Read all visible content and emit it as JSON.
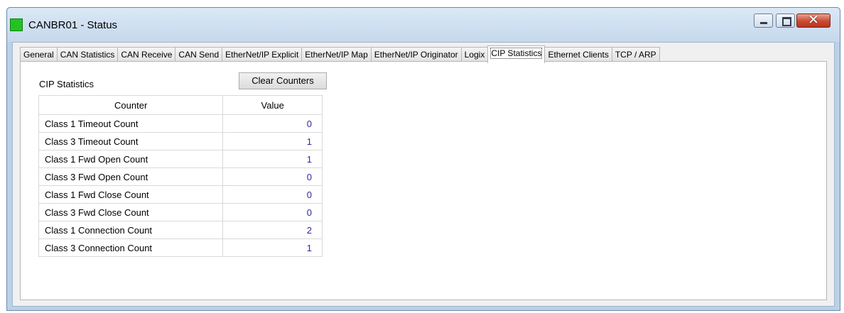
{
  "window": {
    "title": "CANBR01 - Status",
    "icon_color": "#22c322",
    "controls": {
      "minimize": "minimize-icon",
      "maximize": "maximize-icon",
      "close": "close-icon"
    }
  },
  "tabs": [
    {
      "label": "General"
    },
    {
      "label": "CAN Statistics"
    },
    {
      "label": "CAN Receive"
    },
    {
      "label": "CAN Send"
    },
    {
      "label": "EtherNet/IP Explicit"
    },
    {
      "label": "EtherNet/IP Map"
    },
    {
      "label": "EtherNet/IP Originator"
    },
    {
      "label": "Logix"
    },
    {
      "label": "CIP Statistics",
      "active": true
    },
    {
      "label": "Ethernet Clients"
    },
    {
      "label": "TCP / ARP"
    }
  ],
  "cip": {
    "section_label": "CIP Statistics",
    "clear_button": "Clear Counters",
    "columns": [
      "Counter",
      "Value"
    ],
    "rows": [
      {
        "counter": "Class 1 Timeout Count",
        "value": "0"
      },
      {
        "counter": "Class 3 Timeout Count",
        "value": "1"
      },
      {
        "counter": "Class 1 Fwd Open Count",
        "value": "1"
      },
      {
        "counter": "Class 3 Fwd Open Count",
        "value": "0"
      },
      {
        "counter": "Class 1 Fwd Close Count",
        "value": "0"
      },
      {
        "counter": "Class 3 Fwd Close Count",
        "value": "0"
      },
      {
        "counter": "Class 1 Connection Count",
        "value": "2"
      },
      {
        "counter": "Class 3 Connection Count",
        "value": "1"
      }
    ]
  }
}
